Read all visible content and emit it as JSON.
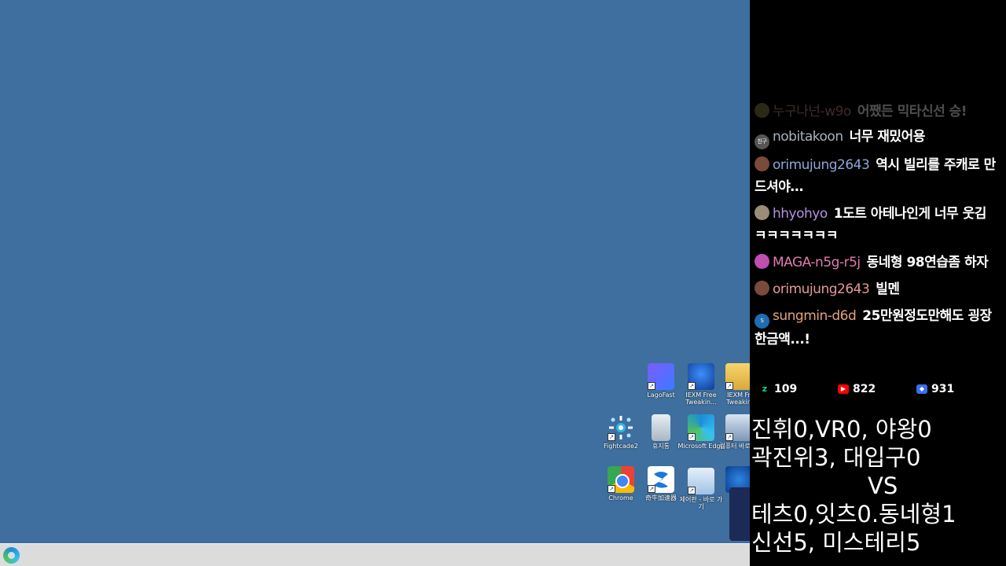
{
  "desktop": {
    "background_color": "#3e6f9e",
    "icons": [
      {
        "name": "lagofast-shortcut",
        "label": "LagoFast",
        "icon": "lagofast-icon"
      },
      {
        "name": "iexm-free-tweaking-zip",
        "label": "IEXM Free Tweakin...",
        "icon": "zip-icon"
      },
      {
        "name": "iexm-free-tweaking-folder",
        "label": "IEXM Fr Tweakin",
        "icon": "folder-icon"
      },
      {
        "name": "fightcade2-shortcut",
        "label": "Fightcade2",
        "icon": "fightcade-icon"
      },
      {
        "name": "recycle-bin",
        "label": "휴지통",
        "icon": "recycle-bin-icon"
      },
      {
        "name": "microsoft-edge-shortcut",
        "label": "Microsoft Edge",
        "icon": "edge-icon"
      },
      {
        "name": "this-pc-shortcut",
        "label": "컴퓨터 바로 가",
        "icon": "computer-icon"
      },
      {
        "name": "chrome-shortcut",
        "label": "Chrome",
        "icon": "chrome-icon"
      },
      {
        "name": "accelerator-shortcut",
        "label": "奇牛加速器",
        "icon": "accelerator-icon"
      },
      {
        "name": "control-panel-shortcut",
        "label": "제어판 - 바로 가기",
        "icon": "control-panel-icon"
      },
      {
        "name": "partial-app-shortcut",
        "label": "",
        "icon": "app-icon"
      }
    ]
  },
  "taskbar": {
    "pinned": [
      {
        "name": "taskbar-edge",
        "icon": "edge-icon"
      }
    ]
  },
  "chat": {
    "messages": [
      {
        "user": "누구나넌-w9o",
        "text": "어쨌든 믹타신선 승!",
        "user_color": "#d58a8a",
        "avatar_color": "#884",
        "faded": true
      },
      {
        "user": "nobitakoon",
        "text": "너무 재밌어용",
        "user_color": "#a9b3bd",
        "avatar_color": "#555",
        "avatar_text": "친구"
      },
      {
        "user": "orimujung2643",
        "text": "역시 빌리를 주캐로 만드셔야…",
        "user_color": "#8da7d8",
        "avatar_color": "#7a4a3a"
      },
      {
        "user": "hhyohyo",
        "text": "1도트 아테나인게 너무 웃김 ㅋㅋㅋㅋㅋㅋㅋ",
        "user_color": "#b493e0",
        "avatar_color": "#9c8c7a"
      },
      {
        "user": "MAGA-n5g-r5j",
        "text": "동네형 98연습좀 하자",
        "user_color": "#e07cae",
        "avatar_color": "#c04fb4"
      },
      {
        "user": "orimujung2643",
        "text": "빌멘",
        "user_color": "#e39a9a",
        "avatar_color": "#7a4a3a"
      },
      {
        "user": "sungmin-d6d",
        "text": "25만원정도만해도 굉장한금액...!",
        "user_color": "#e6a27a",
        "avatar_color": "#1e6db0",
        "avatar_text": "S"
      }
    ]
  },
  "stats": {
    "chzzk": "109",
    "youtube": "822",
    "soop": "931",
    "colors": {
      "chzzk": "#00d98b",
      "youtube": "#ff0000",
      "soop": "#3a6df0"
    }
  },
  "scoreboard": {
    "line1": "진휘0,VR0, 야왕0",
    "line2": "곽진위3, 대입구0",
    "vs": "VS",
    "line3": "테츠0,잇츠0.동네형1",
    "line4": "신선5, 미스테리5"
  }
}
